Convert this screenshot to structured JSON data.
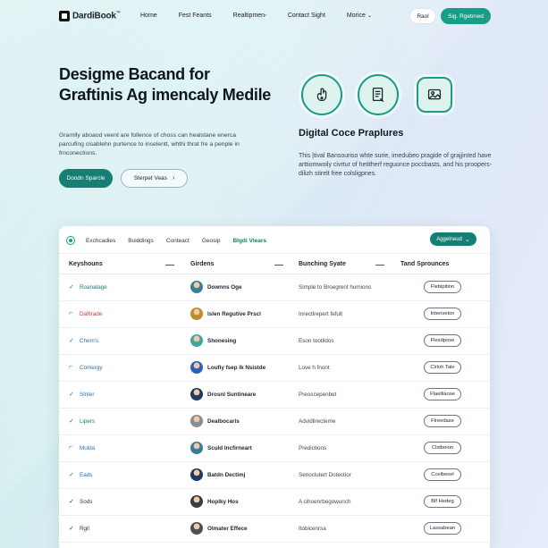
{
  "nav": {
    "logo": "DardiBook",
    "logo_tm": "™",
    "links": [
      "Home",
      "Fest Feants",
      "Realtipmen",
      "Contact Sight",
      "Morice"
    ],
    "login_label": "Raol",
    "signup_label": "Sig. Rgetrned"
  },
  "hero": {
    "title": "Desigme Bacand for Graftinis Ag imencaly Medile",
    "body": "Grarnlly aboaod veent are follence of choss can healstane enerca parcufing cisablehn purtence to inselentt, whthi thrat fre a penple in frnconections.",
    "primary_label": "Doodn Sparcle",
    "secondary_label": "Sterpet Veas",
    "secondary_icon": "chevron-right"
  },
  "feature": {
    "icons": [
      "hand-icon",
      "document-icon",
      "image-badge-icon"
    ],
    "title": "Digital Coce Praplures",
    "body": "This |tival Bansouriso whte surie, imedubeo pragide of grajjinted have arttiomwoily civrtur of hetitherf reguonce poccbasts, and his proopers-dilizh stirelt free colsligpnes."
  },
  "panel": {
    "tabs": [
      "Exchcadies",
      "Buiddings",
      "Conteact",
      "Geosip",
      "Blgdi Vlears"
    ],
    "active_tab": 4,
    "action_label": "Aggelneud",
    "columns": [
      "Keyshouns",
      "Girdens",
      "Bunching Syate",
      "Tand Sprounces"
    ],
    "rows": [
      {
        "check": "✓",
        "name": "Roanatage",
        "name_color": "#137f6a",
        "person": "Downns Oge",
        "avatar": "#3b7f96",
        "desc": "Simple to Broegrent humions",
        "pill": "Flebipition"
      },
      {
        "check": "⌐",
        "name": "Dalfirade",
        "name_color": "#c23a3a",
        "person": "Islen Regutive Prscl",
        "avatar": "#c08a2f",
        "desc": "Inrectlrepert fefult",
        "pill": "Intenveton"
      },
      {
        "check": "✓",
        "name": "Chem's",
        "name_color": "#2a6fb3",
        "person": "Shonesing",
        "avatar": "#3ea7a0",
        "desc": "Eson tootlidos",
        "pill": "Flexdpose"
      },
      {
        "check": "⌐",
        "name": "Comergy",
        "name_color": "#2a6fb3",
        "person": "Loufiy fsep lk Nsistde",
        "avatar": "#2f5fb8",
        "desc": "Love h fnont",
        "pill": "Clrloh Tale"
      },
      {
        "check": "✓",
        "name": "Slnter",
        "name_color": "#2a6fb3",
        "person": "Drosnl Suntineare",
        "avatar": "#1f3b63",
        "desc": "Preoscepenbet",
        "pill": "Flaelliaose"
      },
      {
        "check": "✓",
        "name": "Lipers",
        "name_color": "#137f6a",
        "person": "Dealbocaris",
        "avatar": "#8a8f94",
        "desc": "Advidlirecteme",
        "pill": "Flreedase"
      },
      {
        "check": "⌐",
        "name": "Mulda",
        "name_color": "#2a6fb3",
        "person": "Sculd Incfirneart",
        "avatar": "#3a7d9a",
        "desc": "Predictions",
        "pill": "Clstbeion"
      },
      {
        "check": "✓",
        "name": "Eads",
        "name_color": "#2a6fb3",
        "person": "Batdn Dectimj",
        "avatar": "#1f3b63",
        "desc": "Senoclutert Dotectior",
        "pill": "Ccelbesel"
      },
      {
        "check": "✓",
        "name": "Sods",
        "name_color": "#333333",
        "person": "Hoplky Hos",
        "avatar": "#3a3f45",
        "desc": "A cihoenrbegowunch",
        "pill": "Blf Hedeg"
      },
      {
        "check": "✓",
        "name": "Rgil",
        "name_color": "#333333",
        "person": "Olmater Effece",
        "avatar": "#4a4f55",
        "desc": "Itobicenrsa",
        "pill": "Lassabean"
      }
    ]
  }
}
